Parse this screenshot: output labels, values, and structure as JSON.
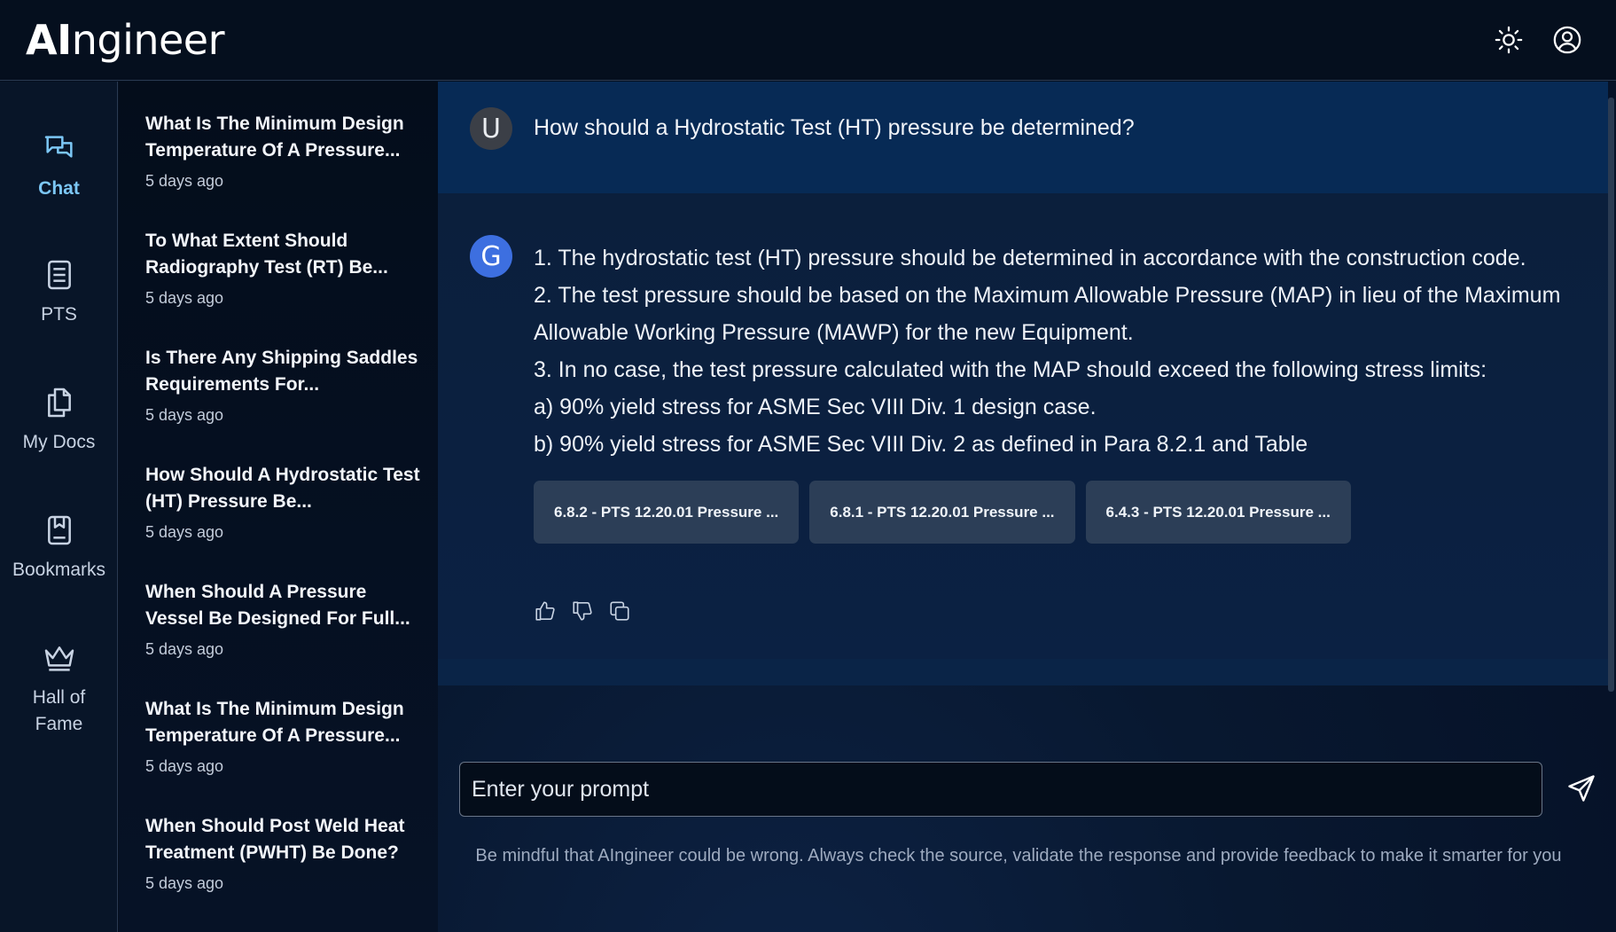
{
  "app": {
    "logo_bold": "AI",
    "logo_rest": "ngineer"
  },
  "header": {
    "theme_icon": "sun-icon",
    "account_icon": "user-circle-icon"
  },
  "nav": {
    "items": [
      {
        "label": "Chat",
        "icon": "chat-icon",
        "active": true
      },
      {
        "label": "PTS",
        "icon": "document-icon"
      },
      {
        "label": "My Docs",
        "icon": "copy-docs-icon"
      },
      {
        "label": "Bookmarks",
        "icon": "bookmark-icon"
      },
      {
        "label": "Hall of\nFame",
        "icon": "crown-icon"
      }
    ]
  },
  "history": {
    "items": [
      {
        "title": "What Is The Minimum Design Temperature Of A Pressure...",
        "time": "5 days ago"
      },
      {
        "title": "To What Extent Should Radiography Test (RT) Be...",
        "time": "5 days ago"
      },
      {
        "title": "Is There Any Shipping Saddles Requirements For...",
        "time": "5 days ago"
      },
      {
        "title": "How Should A Hydrostatic Test (HT) Pressure Be...",
        "time": "5 days ago"
      },
      {
        "title": "When Should A Pressure Vessel Be Designed For Full...",
        "time": "5 days ago"
      },
      {
        "title": "What Is The Minimum Design Temperature Of A Pressure...",
        "time": "5 days ago"
      },
      {
        "title": "When Should Post Weld Heat Treatment (PWHT) Be Done?",
        "time": "5 days ago"
      }
    ]
  },
  "conversation": {
    "user_avatar": "U",
    "user_message": "How should a Hydrostatic Test (HT) pressure be determined?",
    "bot_avatar": "G",
    "answer_lines": [
      "1. The hydrostatic test (HT) pressure should be determined in accordance with the construction code.",
      "2. The test pressure should be based on the Maximum Allowable Pressure (MAP) in lieu of the Maximum",
      "Allowable Working Pressure (MAWP) for the new Equipment.",
      "3. In no case, the test pressure calculated with the MAP should exceed the following stress limits:",
      "a) 90% yield stress for ASME Sec VIII Div. 1 design case.",
      "b) 90% yield stress for ASME Sec VIII Div. 2 as defined in Para 8.2.1 and Table"
    ],
    "sources": [
      "6.8.2 - PTS 12.20.01 Pressure ...",
      "6.8.1 - PTS 12.20.01 Pressure ...",
      "6.4.3 - PTS 12.20.01 Pressure ..."
    ],
    "feedback_icons": [
      "thumbs-up-icon",
      "thumbs-down-icon",
      "copy-icon"
    ]
  },
  "composer": {
    "placeholder": "Enter your prompt",
    "send_icon": "send-icon",
    "disclaimer": "Be mindful that AIngineer could be wrong. Always check the source, validate the response and provide feedback to make it smarter for you"
  },
  "colors": {
    "accent": "#7cc7f5",
    "bot_avatar": "#3d6fe0",
    "user_bubble": "#072a55",
    "source_chip": "#2c3e57"
  }
}
